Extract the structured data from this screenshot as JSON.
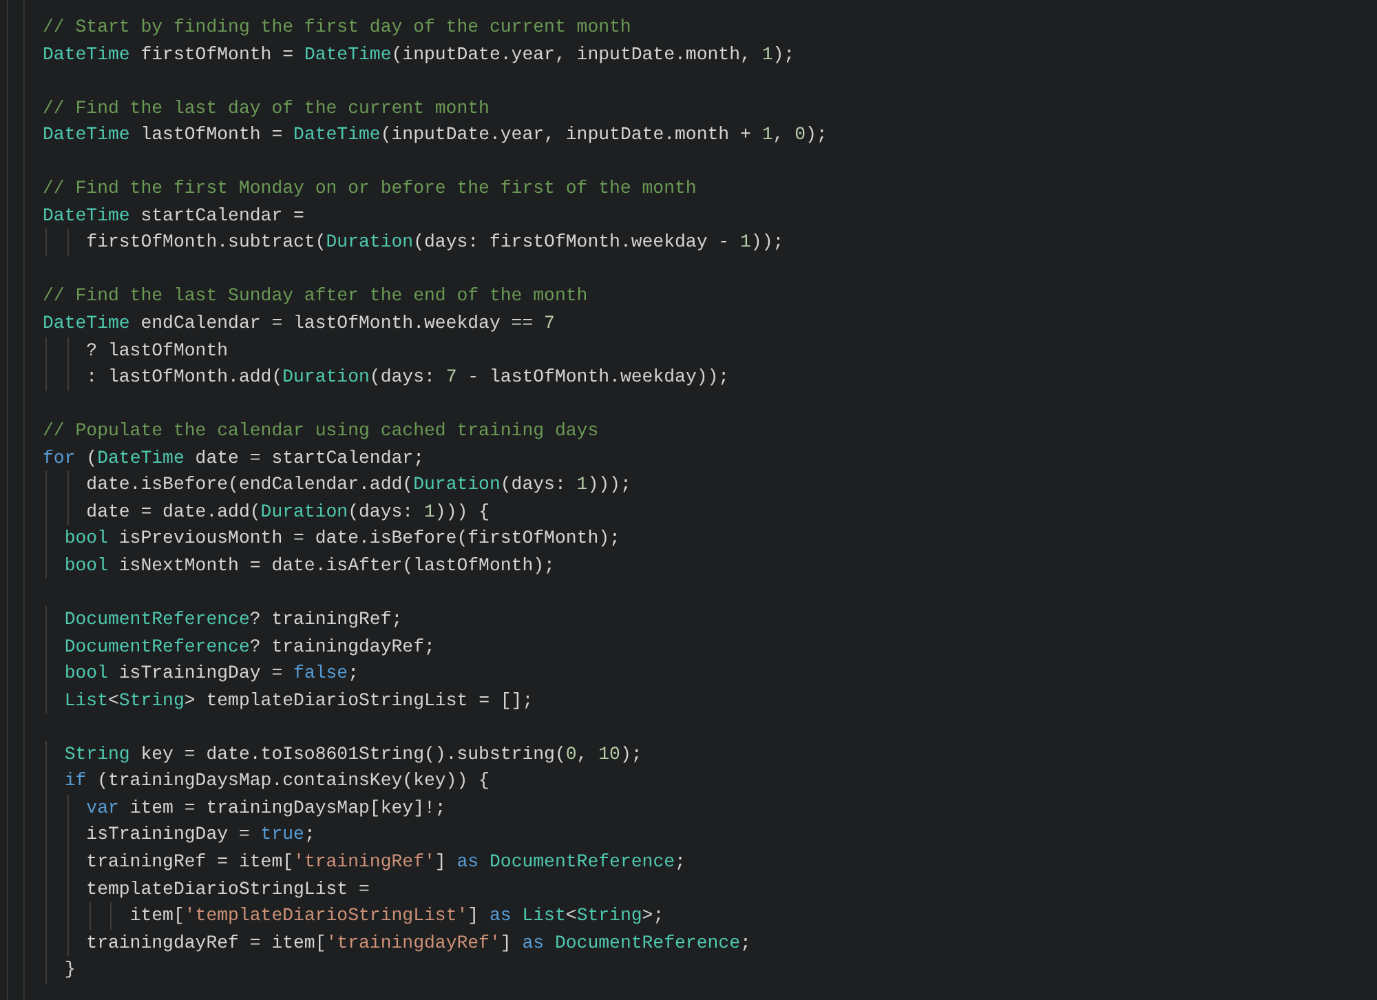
{
  "editor": {
    "lines": [
      {
        "kind": "code",
        "tokens": [
          {
            "kind": "comment",
            "text": "// Start by finding the first day of the current month"
          }
        ]
      },
      {
        "kind": "code",
        "tokens": [
          {
            "kind": "type",
            "text": "DateTime"
          },
          {
            "kind": "plain",
            "text": " firstOfMonth = "
          },
          {
            "kind": "type",
            "text": "DateTime"
          },
          {
            "kind": "plain",
            "text": "(inputDate.year, inputDate.month, "
          },
          {
            "kind": "number",
            "text": "1"
          },
          {
            "kind": "plain",
            "text": ");"
          }
        ]
      },
      {
        "kind": "blank"
      },
      {
        "kind": "code",
        "tokens": [
          {
            "kind": "comment",
            "text": "// Find the last day of the current month"
          }
        ]
      },
      {
        "kind": "code",
        "tokens": [
          {
            "kind": "type",
            "text": "DateTime"
          },
          {
            "kind": "plain",
            "text": " lastOfMonth = "
          },
          {
            "kind": "type",
            "text": "DateTime"
          },
          {
            "kind": "plain",
            "text": "(inputDate.year, inputDate.month + "
          },
          {
            "kind": "number",
            "text": "1"
          },
          {
            "kind": "plain",
            "text": ", "
          },
          {
            "kind": "number",
            "text": "0"
          },
          {
            "kind": "plain",
            "text": ");"
          }
        ]
      },
      {
        "kind": "blank"
      },
      {
        "kind": "code",
        "tokens": [
          {
            "kind": "comment",
            "text": "// Find the first Monday on or before the first of the month"
          }
        ]
      },
      {
        "kind": "code",
        "tokens": [
          {
            "kind": "type",
            "text": "DateTime"
          },
          {
            "kind": "plain",
            "text": " startCalendar ="
          }
        ]
      },
      {
        "kind": "code",
        "tokens": [
          {
            "kind": "plain",
            "text": "    firstOfMonth.subtract("
          },
          {
            "kind": "type",
            "text": "Duration"
          },
          {
            "kind": "plain",
            "text": "(days: firstOfMonth.weekday - "
          },
          {
            "kind": "number",
            "text": "1"
          },
          {
            "kind": "plain",
            "text": "));"
          }
        ]
      },
      {
        "kind": "blank"
      },
      {
        "kind": "code",
        "tokens": [
          {
            "kind": "comment",
            "text": "// Find the last Sunday after the end of the month"
          }
        ]
      },
      {
        "kind": "code",
        "tokens": [
          {
            "kind": "type",
            "text": "DateTime"
          },
          {
            "kind": "plain",
            "text": " endCalendar = lastOfMonth.weekday == "
          },
          {
            "kind": "number",
            "text": "7"
          }
        ]
      },
      {
        "kind": "code",
        "tokens": [
          {
            "kind": "plain",
            "text": "    ? lastOfMonth"
          }
        ]
      },
      {
        "kind": "code",
        "tokens": [
          {
            "kind": "plain",
            "text": "    : lastOfMonth.add("
          },
          {
            "kind": "type",
            "text": "Duration"
          },
          {
            "kind": "plain",
            "text": "(days: "
          },
          {
            "kind": "number",
            "text": "7"
          },
          {
            "kind": "plain",
            "text": " - lastOfMonth.weekday));"
          }
        ]
      },
      {
        "kind": "blank"
      },
      {
        "kind": "code",
        "tokens": [
          {
            "kind": "comment",
            "text": "// Populate the calendar using cached training days"
          }
        ]
      },
      {
        "kind": "code",
        "tokens": [
          {
            "kind": "keyword",
            "text": "for"
          },
          {
            "kind": "plain",
            "text": " ("
          },
          {
            "kind": "type",
            "text": "DateTime"
          },
          {
            "kind": "plain",
            "text": " date = startCalendar;"
          }
        ]
      },
      {
        "kind": "code",
        "tokens": [
          {
            "kind": "plain",
            "text": "    date.isBefore(endCalendar.add("
          },
          {
            "kind": "type",
            "text": "Duration"
          },
          {
            "kind": "plain",
            "text": "(days: "
          },
          {
            "kind": "number",
            "text": "1"
          },
          {
            "kind": "plain",
            "text": ")));"
          }
        ]
      },
      {
        "kind": "code",
        "tokens": [
          {
            "kind": "plain",
            "text": "    date = date.add("
          },
          {
            "kind": "type",
            "text": "Duration"
          },
          {
            "kind": "plain",
            "text": "(days: "
          },
          {
            "kind": "number",
            "text": "1"
          },
          {
            "kind": "plain",
            "text": "))) {"
          }
        ]
      },
      {
        "kind": "code",
        "tokens": [
          {
            "kind": "type",
            "text": "  bool"
          },
          {
            "kind": "plain",
            "text": " isPreviousMonth = date.isBefore(firstOfMonth);"
          }
        ]
      },
      {
        "kind": "code",
        "tokens": [
          {
            "kind": "type",
            "text": "  bool"
          },
          {
            "kind": "plain",
            "text": " isNextMonth = date.isAfter(lastOfMonth);"
          }
        ]
      },
      {
        "kind": "blank"
      },
      {
        "kind": "code",
        "tokens": [
          {
            "kind": "type",
            "text": "  DocumentReference"
          },
          {
            "kind": "plain",
            "text": "? trainingRef;"
          }
        ]
      },
      {
        "kind": "code",
        "tokens": [
          {
            "kind": "type",
            "text": "  DocumentReference"
          },
          {
            "kind": "plain",
            "text": "? trainingdayRef;"
          }
        ]
      },
      {
        "kind": "code",
        "tokens": [
          {
            "kind": "type",
            "text": "  bool"
          },
          {
            "kind": "plain",
            "text": " isTrainingDay = "
          },
          {
            "kind": "keyword",
            "text": "false"
          },
          {
            "kind": "plain",
            "text": ";"
          }
        ]
      },
      {
        "kind": "code",
        "tokens": [
          {
            "kind": "type",
            "text": "  List"
          },
          {
            "kind": "plain",
            "text": "<"
          },
          {
            "kind": "type",
            "text": "String"
          },
          {
            "kind": "plain",
            "text": "> templateDiarioStringList = [];"
          }
        ]
      },
      {
        "kind": "blank"
      },
      {
        "kind": "code",
        "tokens": [
          {
            "kind": "type",
            "text": "  String"
          },
          {
            "kind": "plain",
            "text": " key = date.toIso8601String().substring("
          },
          {
            "kind": "number",
            "text": "0"
          },
          {
            "kind": "plain",
            "text": ", "
          },
          {
            "kind": "number",
            "text": "10"
          },
          {
            "kind": "plain",
            "text": ");"
          }
        ]
      },
      {
        "kind": "code",
        "tokens": [
          {
            "kind": "keyword",
            "text": "  if"
          },
          {
            "kind": "plain",
            "text": " (trainingDaysMap.containsKey(key)) {"
          }
        ]
      },
      {
        "kind": "code",
        "tokens": [
          {
            "kind": "keyword",
            "text": "    var"
          },
          {
            "kind": "plain",
            "text": " item = trainingDaysMap[key]!;"
          }
        ]
      },
      {
        "kind": "code",
        "tokens": [
          {
            "kind": "plain",
            "text": "    isTrainingDay = "
          },
          {
            "kind": "keyword",
            "text": "true"
          },
          {
            "kind": "plain",
            "text": ";"
          }
        ]
      },
      {
        "kind": "code",
        "tokens": [
          {
            "kind": "plain",
            "text": "    trainingRef = item["
          },
          {
            "kind": "string",
            "text": "'trainingRef'"
          },
          {
            "kind": "plain",
            "text": "] "
          },
          {
            "kind": "keyword",
            "text": "as"
          },
          {
            "kind": "type",
            "text": " DocumentReference"
          },
          {
            "kind": "plain",
            "text": ";"
          }
        ]
      },
      {
        "kind": "code",
        "tokens": [
          {
            "kind": "plain",
            "text": "    templateDiarioStringList ="
          }
        ]
      },
      {
        "kind": "code",
        "tokens": [
          {
            "kind": "plain",
            "text": "        item["
          },
          {
            "kind": "string",
            "text": "'templateDiarioStringList'"
          },
          {
            "kind": "plain",
            "text": "] "
          },
          {
            "kind": "keyword",
            "text": "as"
          },
          {
            "kind": "type",
            "text": " List"
          },
          {
            "kind": "plain",
            "text": "<"
          },
          {
            "kind": "type",
            "text": "String"
          },
          {
            "kind": "plain",
            "text": ">;"
          }
        ]
      },
      {
        "kind": "code",
        "tokens": [
          {
            "kind": "plain",
            "text": "    trainingdayRef = item["
          },
          {
            "kind": "string",
            "text": "'trainingdayRef'"
          },
          {
            "kind": "plain",
            "text": "] "
          },
          {
            "kind": "keyword",
            "text": "as"
          },
          {
            "kind": "type",
            "text": " DocumentReference"
          },
          {
            "kind": "plain",
            "text": ";"
          }
        ]
      },
      {
        "kind": "code",
        "tokens": [
          {
            "kind": "plain",
            "text": "  }"
          }
        ]
      }
    ]
  }
}
